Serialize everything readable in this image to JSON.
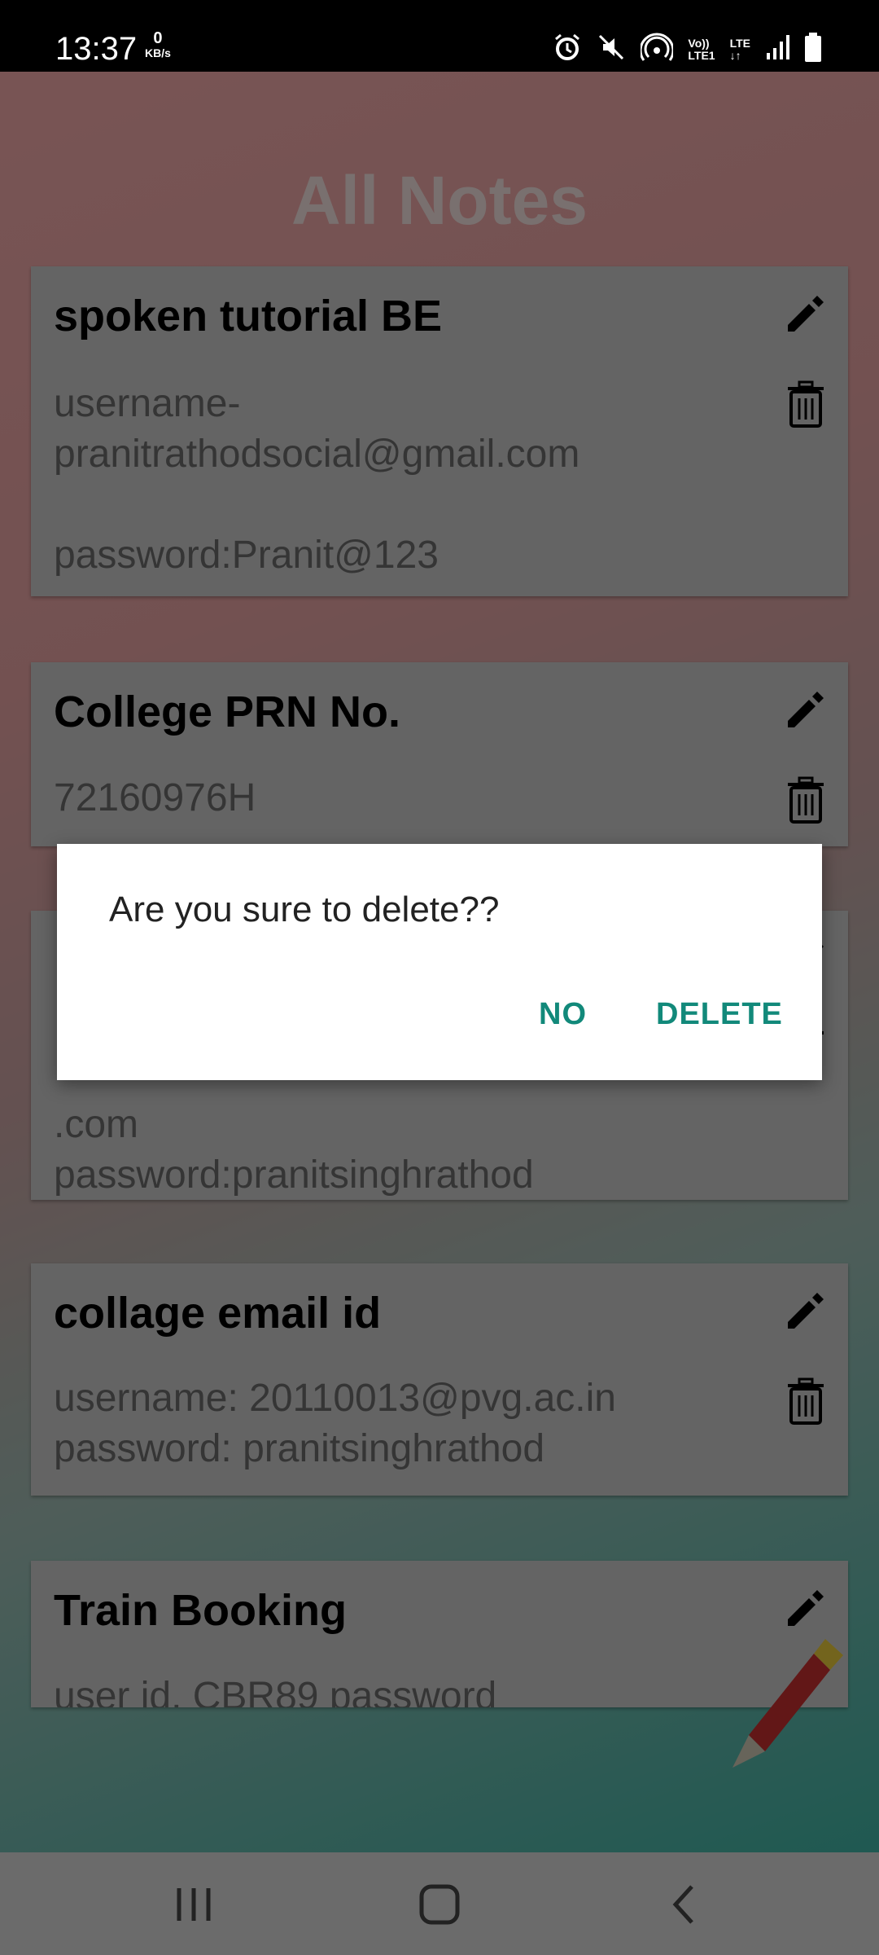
{
  "status": {
    "time": "13:37",
    "speed_value": "0",
    "speed_unit": "KB/s"
  },
  "app": {
    "title": "All Notes"
  },
  "notes": [
    {
      "title": "spoken tutorial BE",
      "body": "username-\npranitrathodsocial@gmail.com\n\npassword:Pranit@123"
    },
    {
      "title": "College PRN No.",
      "body": "72160976H"
    },
    {
      "title": "",
      "body": ".com\npassword:pranitsinghrathod"
    },
    {
      "title": "collage email id",
      "body": "username: 20110013@pvg.ac.in\npassword: pranitsinghrathod"
    },
    {
      "title": "Train Booking",
      "body": "user id. CBR89 password"
    }
  ],
  "dialog": {
    "message": "Are you sure to delete??",
    "no_label": "NO",
    "delete_label": "DELETE"
  },
  "icons": {
    "edit": "pencil-icon",
    "delete": "trash-icon",
    "fab": "pencil-icon"
  },
  "colors": {
    "accent": "#12897a"
  }
}
